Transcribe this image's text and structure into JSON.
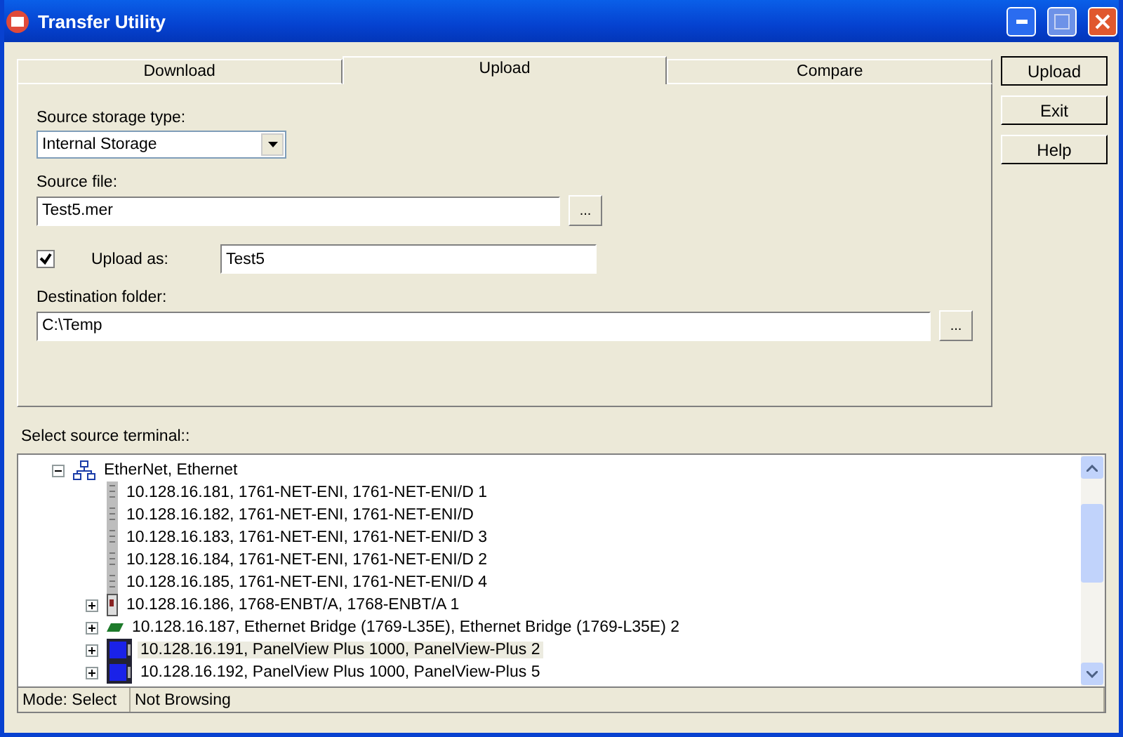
{
  "window": {
    "title": "Transfer Utility"
  },
  "tabs": [
    {
      "label": "Download",
      "selected": false
    },
    {
      "label": "Upload",
      "selected": true
    },
    {
      "label": "Compare",
      "selected": false
    }
  ],
  "form": {
    "storage_label": "Source storage type:",
    "storage_value": "Internal Storage",
    "file_label": "Source file:",
    "file_value": "Test5.mer",
    "browse": "...",
    "upload_as": {
      "checked": true,
      "label": "Upload as:",
      "value": "Test5"
    },
    "dest_label": "Destination folder:",
    "dest_value": "C:\\Temp",
    "dest_browse": "..."
  },
  "buttons": [
    "Upload",
    "Exit",
    "Help"
  ],
  "terminal_label": "Select source terminal::",
  "tree": [
    {
      "label": "EtherNet, Ethernet",
      "kind": "network",
      "expanded": true,
      "selected": false,
      "children": [
        {
          "label": "10.128.16.181, 1761-NET-ENI, 1761-NET-ENI/D 1",
          "kind": "module",
          "selected": false
        },
        {
          "label": "10.128.16.182, 1761-NET-ENI, 1761-NET-ENI/D",
          "kind": "module",
          "selected": false
        },
        {
          "label": "10.128.16.183, 1761-NET-ENI, 1761-NET-ENI/D 3",
          "kind": "module",
          "selected": false
        },
        {
          "label": "10.128.16.184, 1761-NET-ENI, 1761-NET-ENI/D 2",
          "kind": "module",
          "selected": false
        },
        {
          "label": "10.128.16.185, 1761-NET-ENI, 1761-NET-ENI/D 4",
          "kind": "module",
          "selected": false
        },
        {
          "label": "10.128.16.186, 1768-ENBT/A, 1768-ENBT/A 1",
          "kind": "adapter",
          "expanded": false,
          "selected": false
        },
        {
          "label": "10.128.16.187, Ethernet Bridge (1769-L35E), Ethernet Bridge (1769-L35E) 2",
          "kind": "bridge",
          "expanded": false,
          "selected": false
        },
        {
          "label": "10.128.16.191, PanelView Plus 1000, PanelView-Plus 2",
          "kind": "panel",
          "expanded": false,
          "selected": true
        },
        {
          "label": "10.128.16.192, PanelView Plus 1000, PanelView-Plus 5",
          "kind": "panel",
          "expanded": false,
          "selected": false
        }
      ]
    }
  ],
  "status_bar": {
    "mode": "Mode: Select",
    "state": "Not Browsing"
  }
}
